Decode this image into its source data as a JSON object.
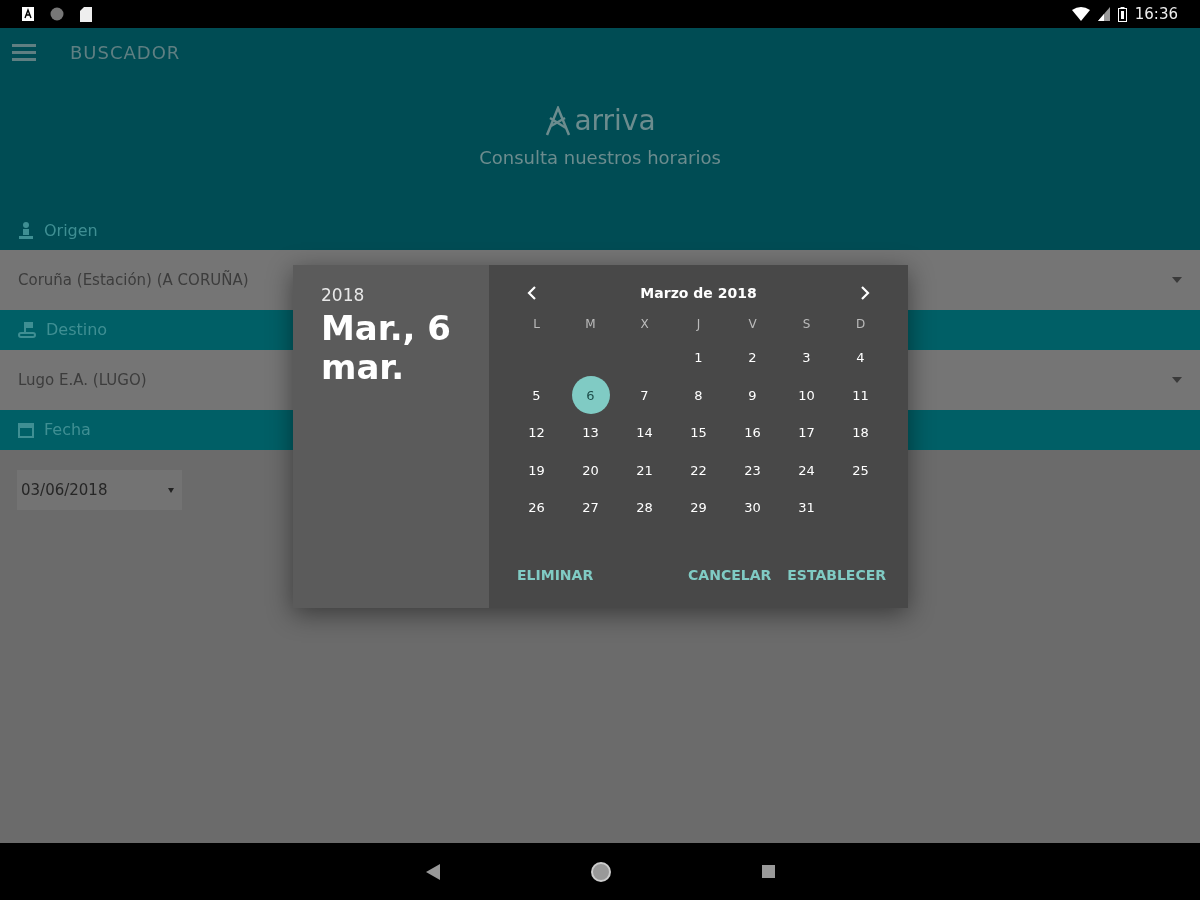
{
  "status_bar": {
    "time": "16:36"
  },
  "app_bar": {
    "title": "BUSCADOR"
  },
  "header": {
    "logo": "arriva",
    "tagline": "Consulta nuestros horarios"
  },
  "sections": [
    {
      "kind": "origin",
      "label": "Origen",
      "field": {
        "kind": "row",
        "value": "Coruña (Estación) (A CORUÑA)"
      }
    },
    {
      "kind": "destination",
      "label": "Destino",
      "field": {
        "kind": "row",
        "value": "Lugo E.A. (LUGO)"
      }
    },
    {
      "kind": "date",
      "label": "Fecha",
      "field": {
        "kind": "compact",
        "value": "03/06/2018"
      }
    }
  ],
  "dialog": {
    "year": "2018",
    "date_title": "Mar., 6 mar.",
    "month_title": "Marzo de 2018",
    "weekdays": [
      "L",
      "M",
      "X",
      "J",
      "V",
      "S",
      "D"
    ],
    "weeks": [
      {
        "kind": "first",
        "days": [
          {
            "label": "1",
            "selected": false
          },
          {
            "label": "2",
            "selected": false
          },
          {
            "label": "3",
            "selected": false
          },
          {
            "label": "4",
            "selected": false
          }
        ]
      },
      {
        "kind": "rest",
        "days": [
          {
            "label": "5",
            "selected": false
          },
          {
            "label": "6",
            "selected": true
          },
          {
            "label": "7",
            "selected": false
          },
          {
            "label": "8",
            "selected": false
          },
          {
            "label": "9",
            "selected": false
          },
          {
            "label": "10",
            "selected": false
          },
          {
            "label": "11",
            "selected": false
          }
        ]
      },
      {
        "kind": "rest",
        "days": [
          {
            "label": "12",
            "selected": false
          },
          {
            "label": "13",
            "selected": false
          },
          {
            "label": "14",
            "selected": false
          },
          {
            "label": "15",
            "selected": false
          },
          {
            "label": "16",
            "selected": false
          },
          {
            "label": "17",
            "selected": false
          },
          {
            "label": "18",
            "selected": false
          }
        ]
      },
      {
        "kind": "rest",
        "days": [
          {
            "label": "19",
            "selected": false
          },
          {
            "label": "20",
            "selected": false
          },
          {
            "label": "21",
            "selected": false
          },
          {
            "label": "22",
            "selected": false
          },
          {
            "label": "23",
            "selected": false
          },
          {
            "label": "24",
            "selected": false
          },
          {
            "label": "25",
            "selected": false
          }
        ]
      },
      {
        "kind": "rest",
        "days": [
          {
            "label": "26",
            "selected": false
          },
          {
            "label": "27",
            "selected": false
          },
          {
            "label": "28",
            "selected": false
          },
          {
            "label": "29",
            "selected": false
          },
          {
            "label": "30",
            "selected": false
          },
          {
            "label": "31",
            "selected": false
          }
        ]
      }
    ],
    "buttons": [
      {
        "kind": "left",
        "label": "ELIMINAR"
      },
      {
        "kind": "right",
        "label": "CANCELAR"
      },
      {
        "kind": "right",
        "label": "ESTABLECER"
      }
    ]
  }
}
